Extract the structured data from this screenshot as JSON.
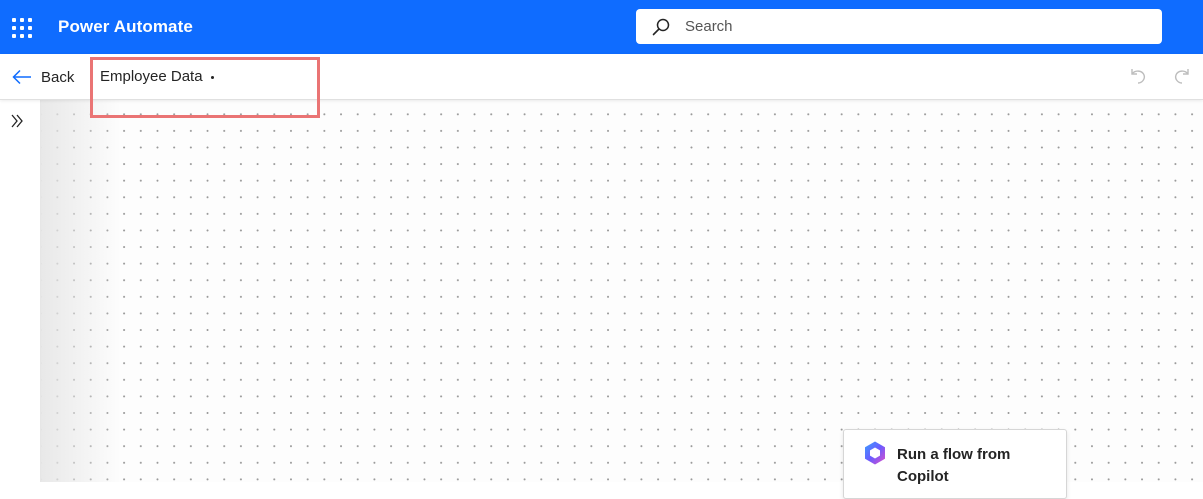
{
  "app": {
    "title": "Power Automate"
  },
  "search": {
    "placeholder": "Search"
  },
  "commandbar": {
    "back_label": "Back",
    "flow_name": "Employee Data"
  },
  "canvas": {
    "nodes": [
      {
        "title": "Run a flow from Copilot"
      }
    ]
  },
  "icons": {
    "app_launcher": "waffle-icon",
    "search": "search-icon",
    "back": "arrow-left-icon",
    "undo": "undo-icon",
    "redo": "redo-icon",
    "expand": "chevron-double-right-icon",
    "copilot": "copilot-icon"
  },
  "colors": {
    "brand": "#0f6cff",
    "highlight": "#ea7474"
  }
}
